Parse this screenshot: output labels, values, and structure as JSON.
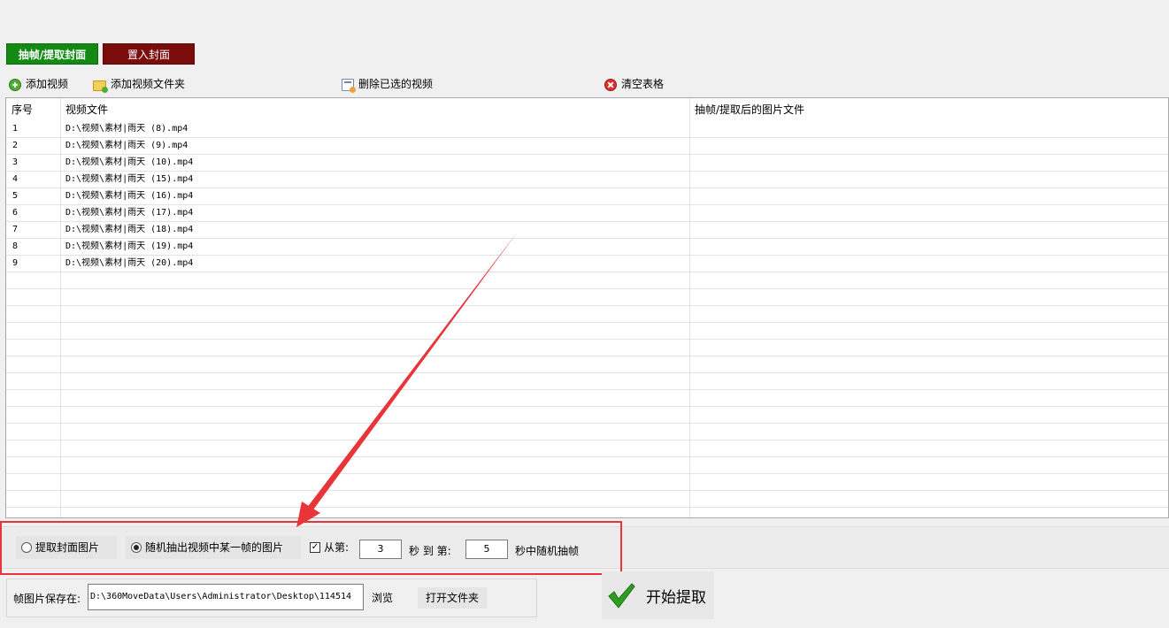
{
  "tabs": {
    "extract_label": "抽帧/提取封面",
    "embed_label": "置入封面"
  },
  "toolbar": {
    "add_video": "添加视频",
    "add_folder": "添加视频文件夹",
    "delete_selected": "删除已选的视频",
    "clear_table": "清空表格"
  },
  "table": {
    "headers": {
      "index": "序号",
      "video_file": "视频文件",
      "output_file": "抽帧/提取后的图片文件"
    },
    "rows": [
      {
        "index": "1",
        "file": "D:\\视频\\素材|雨天 (8).mp4",
        "output": ""
      },
      {
        "index": "2",
        "file": "D:\\视频\\素材|雨天 (9).mp4",
        "output": ""
      },
      {
        "index": "3",
        "file": "D:\\视频\\素材|雨天 (10).mp4",
        "output": ""
      },
      {
        "index": "4",
        "file": "D:\\视频\\素材|雨天 (15).mp4",
        "output": ""
      },
      {
        "index": "5",
        "file": "D:\\视频\\素材|雨天 (16).mp4",
        "output": ""
      },
      {
        "index": "6",
        "file": "D:\\视频\\素材|雨天 (17).mp4",
        "output": ""
      },
      {
        "index": "7",
        "file": "D:\\视频\\素材|雨天 (18).mp4",
        "output": ""
      },
      {
        "index": "8",
        "file": "D:\\视频\\素材|雨天 (19).mp4",
        "output": ""
      },
      {
        "index": "9",
        "file": "D:\\视频\\素材|雨天 (20).mp4",
        "output": ""
      }
    ],
    "empty_row_count": 15
  },
  "options": {
    "radio_cover_label": "提取封面图片",
    "radio_cover_selected": false,
    "radio_random_label": "随机抽出视频中某一帧的图片",
    "radio_random_selected": true,
    "range_checkbox_checked": true,
    "range_checkbox_glyph": "✓",
    "from_label": "从第:",
    "from_value": "3",
    "to_label": "秒 到 第:",
    "to_value": "5",
    "suffix_label": "秒中随机抽帧"
  },
  "save": {
    "label": "帧图片保存在:",
    "path": "D:\\360MoveData\\Users\\Administrator\\Desktop\\114514",
    "browse_label": "浏览",
    "open_folder_label": "打开文件夹"
  },
  "start": {
    "label": "开始提取"
  },
  "colors": {
    "tab_extract": "#138a13",
    "tab_embed": "#7b0c0c",
    "annotation_red": "#e8353a"
  }
}
